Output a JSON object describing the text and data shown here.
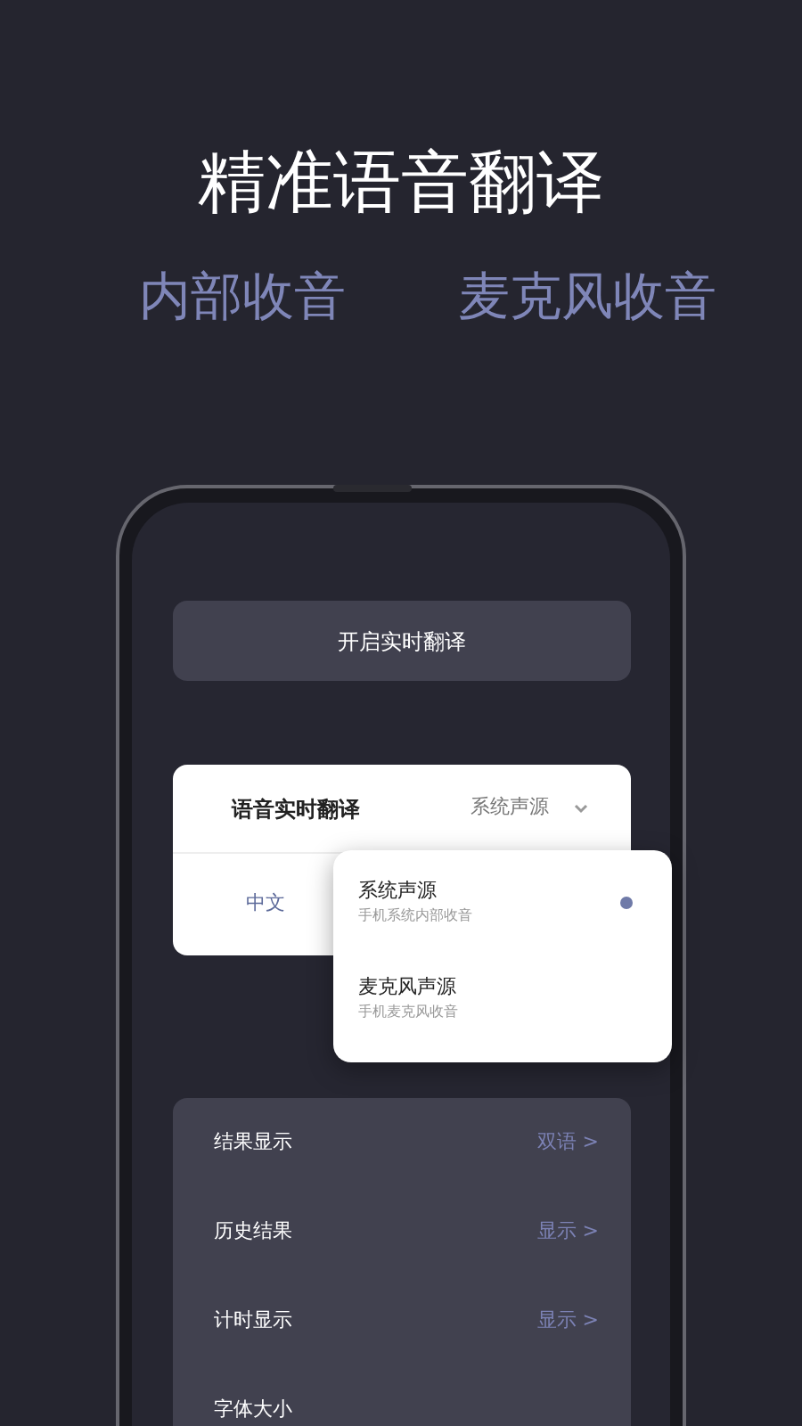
{
  "headline": "精准语音翻译",
  "subtitles": [
    "内部收音",
    "麦克风收音"
  ],
  "phone": {
    "start_button": "开启实时翻译",
    "translate_card": {
      "label": "语音实时翻译",
      "source": "系统声源",
      "language": "中文"
    },
    "source_menu": [
      {
        "title": "系统声源",
        "subtitle": "手机系统内部收音",
        "selected": true
      },
      {
        "title": "麦克风声源",
        "subtitle": "手机麦克风收音",
        "selected": false
      }
    ],
    "settings": [
      {
        "label": "结果显示",
        "value": "双语 >"
      },
      {
        "label": "历史结果",
        "value": "显示 >"
      },
      {
        "label": "计时显示",
        "value": "显示 >"
      },
      {
        "label": "字体大小"
      }
    ]
  }
}
